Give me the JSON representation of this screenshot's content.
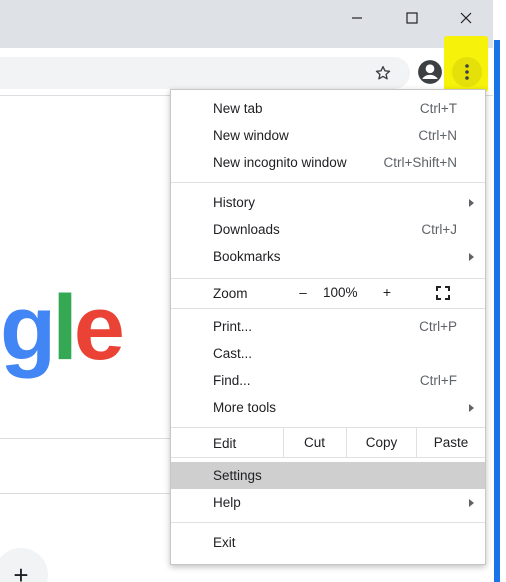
{
  "window": {
    "minimize": "–",
    "maximize": "☐",
    "close": "✕"
  },
  "toolbar": {
    "star_icon": "star-outline-icon",
    "profile_icon": "account-circle-icon",
    "menu_icon": "more-vert-icon"
  },
  "page": {
    "logo_text_g": "g",
    "logo_text_l": "l",
    "logo_text_e": "e",
    "plus": "+"
  },
  "colors": {
    "highlight": "#f6f20a",
    "google_blue": "#4285f4",
    "google_green": "#34a853",
    "google_red": "#ea4335",
    "edge_blue": "#1a73e8",
    "settings_bg": "#cfcfcf"
  },
  "menu": {
    "new_tab": {
      "label": "New tab",
      "shortcut": "Ctrl+T"
    },
    "new_window": {
      "label": "New window",
      "shortcut": "Ctrl+N"
    },
    "new_incognito": {
      "label": "New incognito window",
      "shortcut": "Ctrl+Shift+N"
    },
    "history": {
      "label": "History"
    },
    "downloads": {
      "label": "Downloads",
      "shortcut": "Ctrl+J"
    },
    "bookmarks": {
      "label": "Bookmarks"
    },
    "zoom": {
      "label": "Zoom",
      "minus": "–",
      "value": "100%",
      "plus": "+"
    },
    "print": {
      "label": "Print...",
      "shortcut": "Ctrl+P"
    },
    "cast": {
      "label": "Cast..."
    },
    "find": {
      "label": "Find...",
      "shortcut": "Ctrl+F"
    },
    "more_tools": {
      "label": "More tools"
    },
    "edit": {
      "label": "Edit",
      "cut": "Cut",
      "copy": "Copy",
      "paste": "Paste"
    },
    "settings": {
      "label": "Settings"
    },
    "help": {
      "label": "Help"
    },
    "exit": {
      "label": "Exit"
    }
  }
}
